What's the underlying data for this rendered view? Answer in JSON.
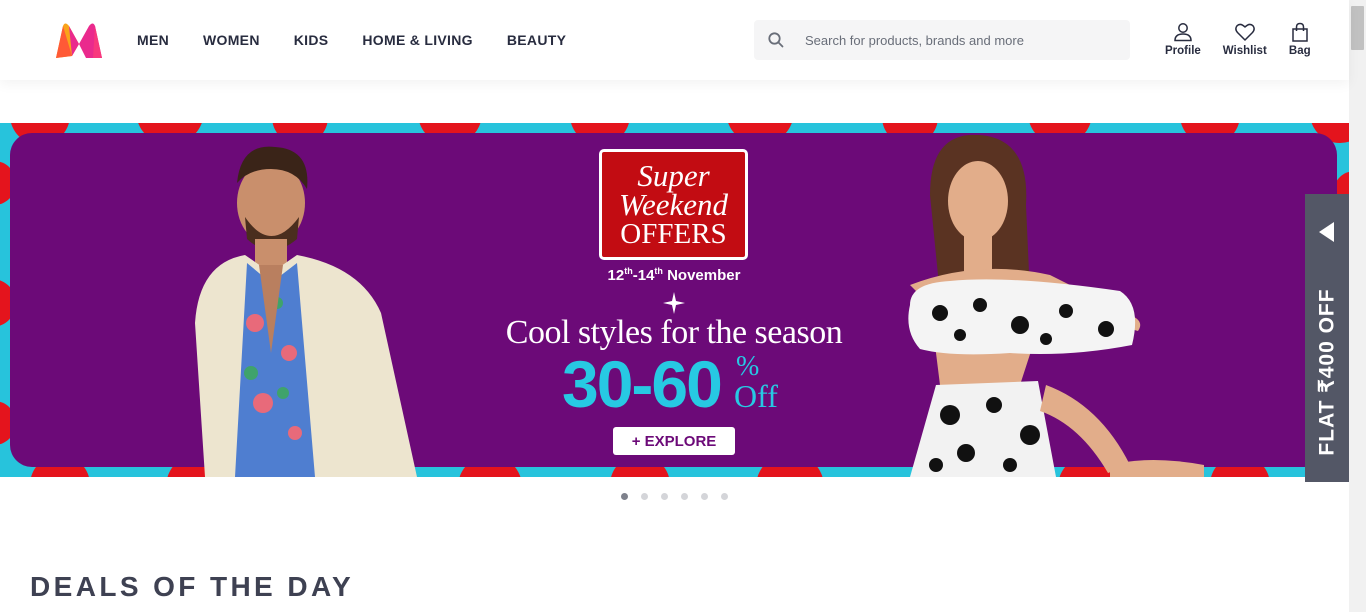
{
  "brand": {
    "logo_icon": "myntra-logo-icon",
    "colors": {
      "accent": "#ff3f6c",
      "logo_orange": "#f9a41a",
      "logo_magenta": "#ea2a8d"
    }
  },
  "nav": {
    "items": [
      {
        "label": "MEN"
      },
      {
        "label": "WOMEN"
      },
      {
        "label": "KIDS"
      },
      {
        "label": "HOME & LIVING"
      },
      {
        "label": "BEAUTY"
      }
    ]
  },
  "search": {
    "placeholder": "Search for products, brands and more",
    "value": "",
    "icon": "search-icon"
  },
  "actions": [
    {
      "label": "Profile",
      "icon": "profile-icon"
    },
    {
      "label": "Wishlist",
      "icon": "heart-icon"
    },
    {
      "label": "Bag",
      "icon": "bag-icon"
    }
  ],
  "banner": {
    "offer_line1": "Super",
    "offer_line2": "Weekend",
    "offer_line3": "OFFERS",
    "dates_start": "12",
    "dates_start_sup": "th",
    "dates_sep": "-",
    "dates_end": "14",
    "dates_end_sup": "th",
    "dates_month": " November",
    "tagline": "Cool styles for the season",
    "discount_range": "30-60",
    "discount_pct": "%",
    "discount_off": "Off",
    "explore_label": "+ EXPLORE",
    "colors": {
      "purple": "#6c0a78",
      "cyan": "#27c3dc",
      "red": "#e4141d",
      "offer_red": "#c20c12"
    }
  },
  "side_offer": {
    "label": "FLAT ₹400 OFF",
    "icon": "arrow-left-icon"
  },
  "carousel": {
    "slide_count": 6,
    "active_index": 0
  },
  "section": {
    "title": "DEALS OF THE DAY"
  }
}
